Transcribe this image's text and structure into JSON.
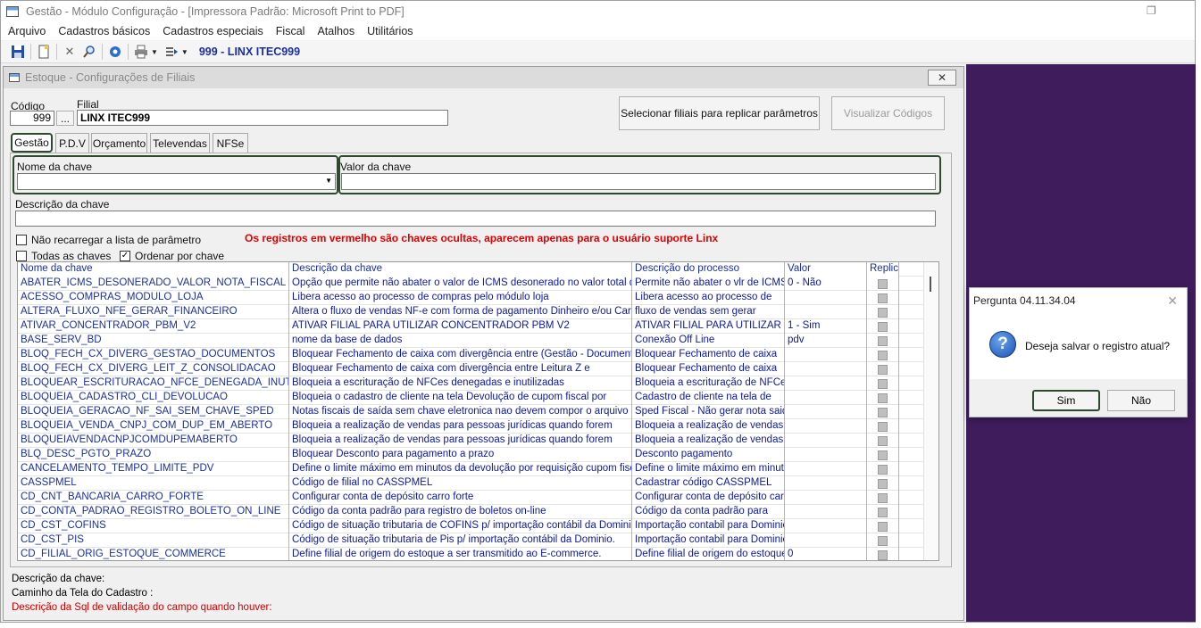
{
  "window": {
    "title": "Gestão  - Módulo Configuração - [Impressora Padrão: Microsoft Print to PDF]"
  },
  "menu": [
    "Arquivo",
    "Cadastros básicos",
    "Cadastros especiais",
    "Fiscal",
    "Atalhos",
    "Utilitários"
  ],
  "toolbar": {
    "icons": [
      "save-icon",
      "new-icon",
      "delete-icon",
      "search-icon",
      "settings-icon",
      "print-icon",
      "export-icon"
    ],
    "company": "999 - LINX ITEC999"
  },
  "child": {
    "title": "Estoque - Configurações de Filiais",
    "codigo_label": "Código",
    "codigo_value": "999",
    "lookup_label": "...",
    "filial_label": "Filial",
    "filial_value": "LINX ITEC999",
    "btn_replicar": "Selecionar filiais para replicar parâmetros",
    "btn_visualizar": "Visualizar Códigos",
    "tabs": [
      "Gestão",
      "P.D.V",
      "Orçamento",
      "Televendas",
      "NFSe"
    ],
    "nome_chave_label": "Nome da chave",
    "valor_chave_label": "Valor da chave",
    "descricao_chave_label": "Descrição da chave",
    "chk_nao_recarregar": "Não recarregar a lista de parâmetro",
    "chk_todas": "Todas as chaves",
    "chk_ordenar": "Ordenar por chave",
    "warning": "Os registros em vermelho são chaves ocultas, aparecem apenas para o usuário suporte Linx",
    "warning_color": "#e00000"
  },
  "grid": {
    "headers": [
      "Nome da chave",
      "Descrição  da chave",
      "Descrição do processo",
      "Valor",
      "Replic"
    ],
    "rows": [
      [
        "ABATER_ICMS_DESONERADO_VALOR_NOTA_FISCAL",
        "Opção que permite não abater o valor de ICMS desonerado no valor total da",
        "Permite não abater o vlr de ICMS",
        "0 - Não"
      ],
      [
        "ACESSO_COMPRAS_MODULO_LOJA",
        "Libera acesso ao processo de compras pelo módulo loja",
        "Libera acesso ao processo de",
        ""
      ],
      [
        "ALTERA_FLUXO_NFE_GERAR_FINANCEIRO",
        "Altera o fluxo de vendas NF-e com forma de pagamento Dinheiro e/ou Cartão",
        "fluxo de vendas sem gerar",
        ""
      ],
      [
        "ATIVAR_CONCENTRADOR_PBM_V2",
        "ATIVAR FILIAL PARA UTILIZAR CONCENTRADOR PBM V2",
        "ATIVAR FILIAL PARA UTILIZAR",
        "1 - Sim"
      ],
      [
        "BASE_SERV_BD",
        "nome da base de dados",
        "Conexão Off Line",
        "pdv"
      ],
      [
        "BLOQ_FECH_CX_DIVERG_GESTAO_DOCUMENTOS",
        "Bloquear Fechamento de caixa com divergência entre (Gestão - Documentos).",
        "Bloquear Fechamento de caixa",
        ""
      ],
      [
        "BLOQ_FECH_CX_DIVERG_LEIT_Z_CONSOLIDACAO",
        "Bloquear Fechamento de caixa com divergência entre Leitura Z e",
        "Bloquear Fechamento de caixa",
        ""
      ],
      [
        "BLOQUEAR_ESCRITURACAO_NFCE_DENEGADA_INUTILIZ",
        "Bloqueia a escrituração de NFCes denegadas e inutilizadas",
        "Bloqueia a escrituração de NFCes",
        ""
      ],
      [
        "BLOQUEIA_CADASTRO_CLI_DEVOLUCAO",
        "Bloqueia o cadastro de cliente na tela Devolução de cupom fiscal por",
        "Cadastro de cliente na tela de",
        ""
      ],
      [
        "BLOQUEIA_GERACAO_NF_SAI_SEM_CHAVE_SPED",
        "Notas fiscais de saída sem chave eletronica nao devem compor o arquivo do",
        "Sped Fiscal - Não gerar nota saida",
        ""
      ],
      [
        "BLOQUEIA_VENDA_CNPJ_COM_DUP_EM_ABERTO",
        "Bloqueia a realização de vendas para pessoas jurídicas quando forem",
        "Bloqueia a realização de vendas",
        ""
      ],
      [
        "BLOQUEIAVENDACNPJCOMDUPEMABERTO",
        "Bloqueia a realização de vendas para pessoas jurídicas quando forem",
        "Bloqueia a realização de vendas",
        ""
      ],
      [
        "BLQ_DESC_PGTO_PRAZO",
        "Bloquear Desconto para pagamento a prazo",
        "Desconto pagamento",
        ""
      ],
      [
        "CANCELAMENTO_TEMPO_LIMITE_PDV",
        "Define o limite máximo em minutos da devolução por requisição cupom fiscal",
        "Define o limite máximo em minutos",
        ""
      ],
      [
        "CASSPMEL",
        "Código de filial no CASSPMEL",
        "Cadastrar código CASSPMEL",
        ""
      ],
      [
        "CD_CNT_BANCARIA_CARRO_FORTE",
        "Configurar conta de depósito carro forte",
        "Configurar conta de depósito carro",
        ""
      ],
      [
        "CD_CONTA_PADRAO_REGISTRO_BOLETO_ON_LINE",
        "Código da conta padrão para registro de boletos on-line",
        "Código da conta padrão para",
        ""
      ],
      [
        "CD_CST_COFINS",
        "Código de situação tributaria de COFINS  p/ importação contábil da Dominio.",
        "Importação contabil para Dominio",
        ""
      ],
      [
        "CD_CST_PIS",
        "Código de situação tributaria de Pis  p/ importação contábil da Dominio.",
        "Importação contabil para Dominio",
        ""
      ],
      [
        "CD_FILIAL_ORIG_ESTOQUE_COMMERCE",
        "Define filial de origem do estoque a ser transmitido ao E-commerce.",
        "Define filial de origem do estoque a",
        "0"
      ]
    ]
  },
  "footer": {
    "descricao": "Descrição da chave:",
    "caminho": "Caminho da Tela do Cadastro :",
    "sql": "Descrição da Sql de validação do campo quando houver:"
  },
  "dialog": {
    "title": "Pergunta 04.11.34.04",
    "message": "Deseja salvar o registro atual?",
    "btn_yes": "Sim",
    "btn_no": "Não"
  }
}
